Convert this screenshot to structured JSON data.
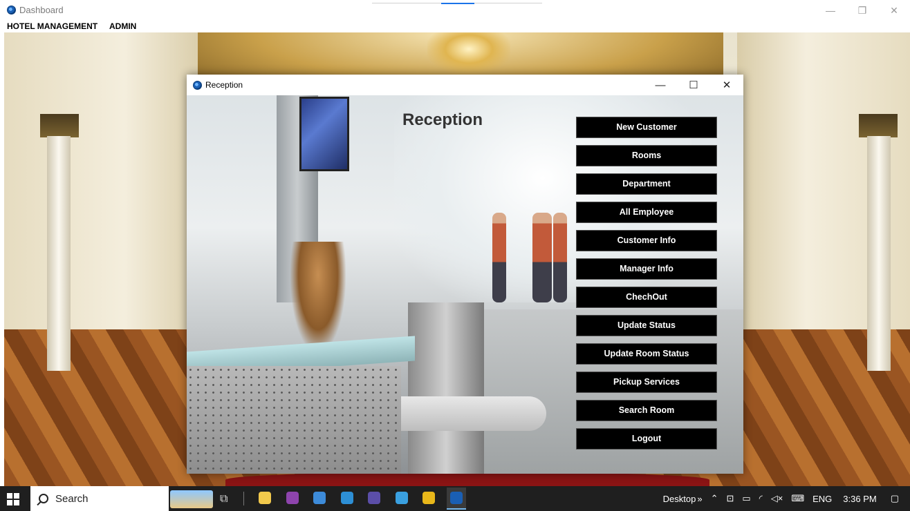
{
  "dashboard": {
    "window_title": "Dashboard",
    "menu": [
      "HOTEL MANAGEMENT",
      "ADMIN"
    ],
    "controls": {
      "minimize": "—",
      "maximize": "❐",
      "close": "✕"
    }
  },
  "reception": {
    "window_title": "Reception",
    "heading": "Reception",
    "controls": {
      "minimize": "—",
      "maximize": "☐",
      "close": "✕"
    },
    "buttons": [
      "New Customer",
      "Rooms",
      "Department",
      "All Employee",
      "Customer Info",
      "Manager Info",
      "ChechOut",
      "Update Status",
      "Update Room Status",
      "Pickup Services",
      "Search Room",
      "Logout"
    ]
  },
  "taskbar": {
    "search_label": "Search",
    "desktop_label": "Desktop",
    "chevron": "»",
    "language": "ENG",
    "time": "3:36 PM",
    "apps": [
      {
        "name": "file-explorer-icon",
        "color": "#f2c94c"
      },
      {
        "name": "github-desktop-icon",
        "color": "#8e44ad"
      },
      {
        "name": "app-icon",
        "color": "#3d8bd9"
      },
      {
        "name": "vscode-icon",
        "color": "#2d8fd5"
      },
      {
        "name": "visual-studio-icon",
        "color": "#5b4ea8"
      },
      {
        "name": "app-2-icon",
        "color": "#3aa0e0"
      },
      {
        "name": "chrome-icon",
        "color": "#e8b71a"
      },
      {
        "name": "java-app-icon",
        "color": "#1a5fb4"
      }
    ]
  }
}
